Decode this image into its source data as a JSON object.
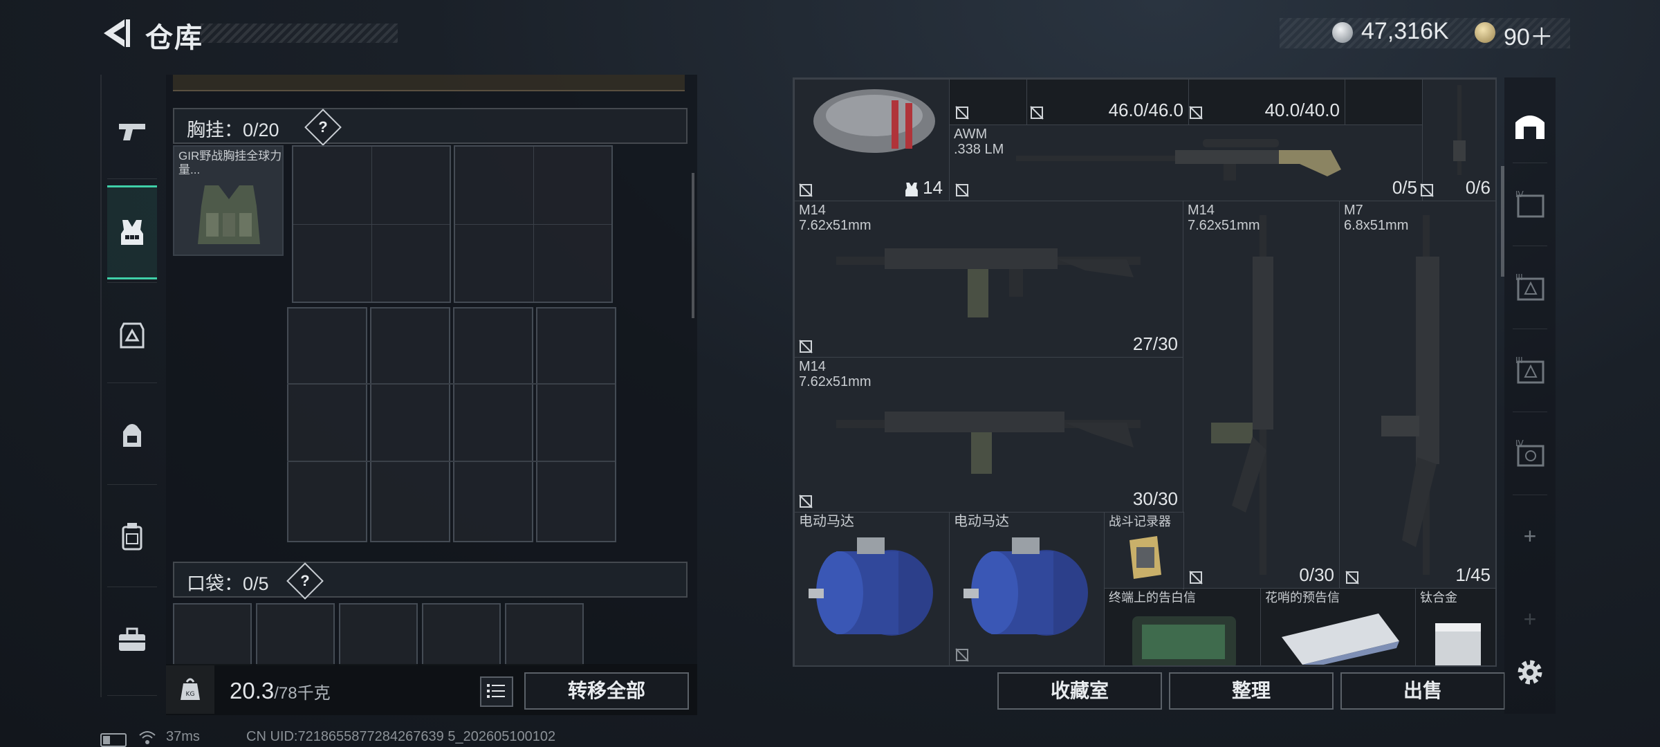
{
  "header": {
    "title": "仓库",
    "currency": {
      "coins": "47,316K",
      "bonds": "90＋"
    }
  },
  "left_nav": {
    "items": [
      {
        "name": "weapons",
        "icon": "pistol-icon"
      },
      {
        "name": "chest-rig",
        "icon": "vest-icon",
        "active": true
      },
      {
        "name": "armor",
        "icon": "armor-icon"
      },
      {
        "name": "backpack",
        "icon": "backpack-icon"
      },
      {
        "name": "pouch",
        "icon": "pouch-icon"
      },
      {
        "name": "case",
        "icon": "toolbox-icon"
      }
    ]
  },
  "inventory": {
    "chest_rig": {
      "label": "胸挂：",
      "value": "0/20",
      "help": "?",
      "item_name": "GIR野战胸挂全球力量..."
    },
    "pockets": {
      "label": "口袋：",
      "value": "0/5",
      "help": "?"
    },
    "weight": {
      "current": "20.3",
      "max": "/78千克"
    },
    "transfer_all": "转移全部"
  },
  "stash": {
    "items": [
      {
        "id": "bag",
        "label": "",
        "count": "14",
        "count_icon": "vest-icon"
      },
      {
        "id": "durability-1",
        "count": "46.0/46.0"
      },
      {
        "id": "durability-2",
        "count": "40.0/40.0"
      },
      {
        "id": "awm",
        "label": "AWM\n.338 LM",
        "count": "0/5"
      },
      {
        "id": "small-rifle",
        "count": "0/6"
      },
      {
        "id": "m14-a",
        "label": "M14\n7.62x51mm",
        "count": "27/30"
      },
      {
        "id": "m14-b",
        "label": "M14\n7.62x51mm",
        "count": "30/30"
      },
      {
        "id": "m14-c",
        "label": "M14\n7.62x51mm",
        "count": "0/30"
      },
      {
        "id": "m7",
        "label": "M7\n6.8x51mm",
        "count": "1/45"
      },
      {
        "id": "motor-1",
        "label": "电动马达"
      },
      {
        "id": "motor-2",
        "label": "电动马达"
      },
      {
        "id": "recorder",
        "label": "战斗记录器"
      },
      {
        "id": "terminal-letter",
        "label": "终端上的告白信"
      },
      {
        "id": "fancy-letter",
        "label": "花哨的预告信"
      },
      {
        "id": "titanium",
        "label": "钛合金"
      }
    ],
    "buttons": {
      "collection": "收藏室",
      "sort": "整理",
      "sell": "出售"
    }
  },
  "right_tabs": [
    "home-icon",
    "tier4-case-icon",
    "tier3-armor-icon",
    "tier3-helmet-icon",
    "tier4-tool-icon",
    "plus-icon",
    "plus-icon"
  ],
  "footer": {
    "ping": "37ms",
    "uid": "CN UID:7218655877284267639 5_202605100102"
  },
  "colors": {
    "accent": "#3fcfa8",
    "panel": "#1e2329"
  }
}
